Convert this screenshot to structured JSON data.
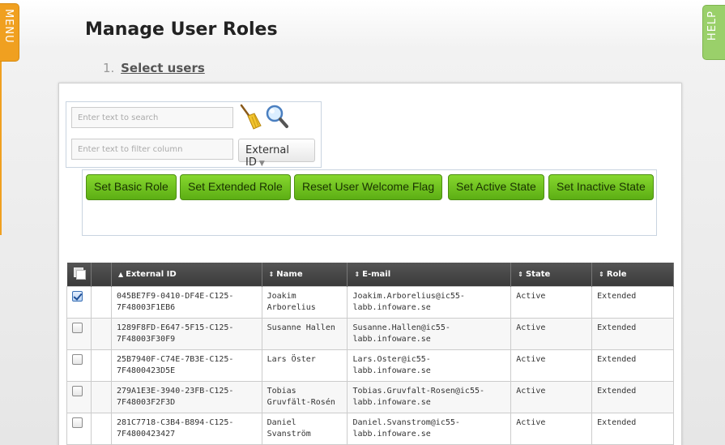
{
  "side_tabs": {
    "menu": "MENU",
    "help": "HELP"
  },
  "header": {
    "title": "Manage User Roles"
  },
  "steps": [
    {
      "number": "1.",
      "label": "Select users"
    }
  ],
  "search": {
    "search_placeholder": "Enter text to search",
    "filter_placeholder": "Enter text to filter column",
    "column_select": "External ID"
  },
  "icons": {
    "clear": "broom-icon",
    "search": "magnifier-icon"
  },
  "actions": [
    "Set Basic Role",
    "Set Extended Role",
    "Reset User Welcome Flag",
    "Set Active State",
    "Set Inactive State"
  ],
  "table": {
    "columns": [
      "External ID",
      "Name",
      "E-mail",
      "State",
      "Role"
    ],
    "sort_column": "External ID",
    "rows": [
      {
        "checked": true,
        "external_id": "045BE7F9-0410-DF4E-C125-7F48003F1EB6",
        "name": "Joakim Arborelius",
        "email": "Joakim.Arborelius@ic55-labb.infoware.se",
        "state": "Active",
        "role": "Extended"
      },
      {
        "checked": false,
        "external_id": "1289F8FD-E647-5F15-C125-7F48003F30F9",
        "name": "Susanne Hallen",
        "email": "Susanne.Hallen@ic55-labb.infoware.se",
        "state": "Active",
        "role": "Extended"
      },
      {
        "checked": false,
        "external_id": "25B7940F-C74E-7B3E-C125-7F4800423D5E",
        "name": "Lars Öster",
        "email": "Lars.Oster@ic55-labb.infoware.se",
        "state": "Active",
        "role": "Extended"
      },
      {
        "checked": false,
        "external_id": "279A1E3E-3940-23FB-C125-7F48003F2F3D",
        "name": "Tobias Gruvfält-Rosén",
        "email": "Tobias.Gruvfalt-Rosen@ic55-labb.infoware.se",
        "state": "Active",
        "role": "Extended"
      },
      {
        "checked": false,
        "external_id": "281C7718-C3B4-B894-C125-7F4800423427",
        "name": "Daniel Svanström",
        "email": "Daniel.Svanstrom@ic55-labb.infoware.se",
        "state": "Active",
        "role": "Extended"
      }
    ]
  },
  "colors": {
    "action_green": "#6cc21f",
    "menu_orange": "#f0a020",
    "help_green": "#9ad06a",
    "header_dark": "#444444"
  }
}
